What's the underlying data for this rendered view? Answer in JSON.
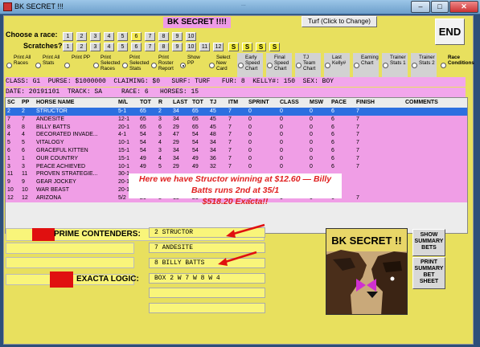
{
  "window": {
    "title": "BK SECRET !!!",
    "faint_title": "...",
    "controls": [
      "–",
      "□",
      "✕"
    ]
  },
  "header": {
    "app_title": "BK SECRET !!!!",
    "turf_button": "Turf (Click to Change)",
    "end_button": "END"
  },
  "race_selector": {
    "label": "Choose  a race:",
    "numbers": [
      "1",
      "2",
      "3",
      "4",
      "5",
      "6",
      "7",
      "8",
      "9",
      "10"
    ],
    "selected": "6"
  },
  "scratches": {
    "label": "Scratches?",
    "numbers": [
      "1",
      "2",
      "3",
      "4",
      "5",
      "6",
      "7",
      "8",
      "9",
      "10",
      "11",
      "12"
    ],
    "s_buttons": [
      "S",
      "S",
      "S",
      "S"
    ]
  },
  "options": [
    {
      "label": "Print All Races",
      "selected": false
    },
    {
      "label": "Print All Stats",
      "selected": false
    },
    {
      "label": "Print PP",
      "selected": false
    },
    {
      "label": "Print Selected Races",
      "selected": false
    },
    {
      "label": "Print Selected Stats",
      "selected": false
    },
    {
      "label": "Print Roster Report",
      "selected": false
    },
    {
      "label": "Show PP",
      "selected": true
    },
    {
      "label": "Select New Card",
      "selected": false
    },
    {
      "label": "Early Speed Chart",
      "selected": false
    },
    {
      "label": "Final Speed Chart",
      "selected": false
    },
    {
      "label": "TJ Team Chart",
      "selected": false
    },
    {
      "label": "Last Kelly#",
      "selected": false
    },
    {
      "label": "Earning Chart",
      "selected": false
    },
    {
      "label": "Trainer Stats 1",
      "selected": false
    },
    {
      "label": "Trainer Stats 2",
      "selected": false
    },
    {
      "label": "Race Conditions",
      "selected": false
    }
  ],
  "race_info": {
    "line1": "CLASS: G1  PURSE: $1000000  CLAIMING: $0   SURF: TURF   FUR: 8  KELLY#: 150  SEX: BOY",
    "line2": "DATE: 20191101  TRACK: SA     RACE: 6   HORSES: 15"
  },
  "table": {
    "headers": [
      "SC",
      "PP",
      "HORSE NAME",
      "M/L",
      "TOT",
      "R",
      "LAST",
      "TOT",
      "TJ",
      "ITM",
      "SPRINT",
      "CLASS",
      "MSW",
      "PACE",
      "FINISH",
      "COMMENTS"
    ],
    "rows": [
      [
        "2",
        "2",
        "STRUCTOR",
        "5-1",
        "65",
        "2",
        "34",
        "65",
        "45",
        "7",
        "0",
        "0",
        "0",
        "6",
        "7",
        ""
      ],
      [
        "7",
        "7",
        "ANDESITE",
        "12-1",
        "65",
        "3",
        "34",
        "65",
        "45",
        "7",
        "0",
        "0",
        "0",
        "6",
        "7",
        ""
      ],
      [
        "8",
        "8",
        "BILLY BATTS",
        "20-1",
        "65",
        "6",
        "29",
        "65",
        "45",
        "7",
        "0",
        "0",
        "0",
        "6",
        "7",
        ""
      ],
      [
        "4",
        "4",
        "DECORATED INVADE...",
        "4-1",
        "54",
        "3",
        "47",
        "54",
        "48",
        "7",
        "0",
        "0",
        "0",
        "6",
        "7",
        ""
      ],
      [
        "5",
        "5",
        "VITALOGY",
        "10-1",
        "54",
        "4",
        "29",
        "54",
        "34",
        "7",
        "0",
        "0",
        "0",
        "6",
        "7",
        ""
      ],
      [
        "6",
        "6",
        "GRACEFUL KITTEN",
        "15-1",
        "54",
        "3",
        "34",
        "54",
        "34",
        "7",
        "0",
        "0",
        "0",
        "6",
        "7",
        ""
      ],
      [
        "1",
        "1",
        "OUR COUNTRY",
        "15-1",
        "49",
        "4",
        "34",
        "49",
        "36",
        "7",
        "0",
        "0",
        "0",
        "6",
        "7",
        ""
      ],
      [
        "3",
        "3",
        "PEACE ACHIEVED",
        "10-1",
        "49",
        "5",
        "29",
        "49",
        "32",
        "7",
        "0",
        "0",
        "0",
        "6",
        "7",
        ""
      ],
      [
        "11",
        "11",
        "PROVEN STRATEGIE...",
        "30-1",
        "",
        "",
        "",
        "",
        "",
        "",
        "",
        "",
        "",
        "",
        "",
        ""
      ],
      [
        "9",
        "9",
        "GEAR JOCKEY",
        "20-1",
        "",
        "",
        "",
        "",
        "",
        "",
        "",
        "",
        "",
        "",
        "",
        ""
      ],
      [
        "10",
        "10",
        "WAR BEAST",
        "20-1",
        "",
        "",
        "",
        "",
        "",
        "",
        "",
        "",
        "",
        "",
        "",
        ""
      ],
      [
        "12",
        "12",
        "ARIZONA",
        "5/2",
        "26",
        "8",
        "15",
        "26",
        "20",
        "7",
        "0",
        "0",
        "0",
        "6",
        "7",
        ""
      ]
    ]
  },
  "annotation": {
    "line1": "Here we have Structor winning at $12.60 — Billy Batts runs 2nd at 35/1",
    "line2": "$518.20 Exacta!!"
  },
  "contenders": {
    "label": "PRIME CONTENDERS:",
    "values": [
      "2     STRUCTOR",
      "7     ANDESITE",
      "8     BILLY BATTS"
    ]
  },
  "exacta": {
    "label": "EXACTA LOGIC:",
    "value": "BOX 2  W 7  W 8  W 4"
  },
  "logo_text": "BK SECRET !!",
  "side_buttons": {
    "summary": "SHOW SUMMARY BETS",
    "print": "PRINT SUMMARY BET SHEET"
  },
  "colors": {
    "form_bg": "#e8e05e",
    "pink_row": "#f09ee6",
    "selected_row": "#2c6fe0",
    "annotation_text": "#e02020",
    "field_bg": "#f9f57a",
    "red_block": "#e01010"
  }
}
